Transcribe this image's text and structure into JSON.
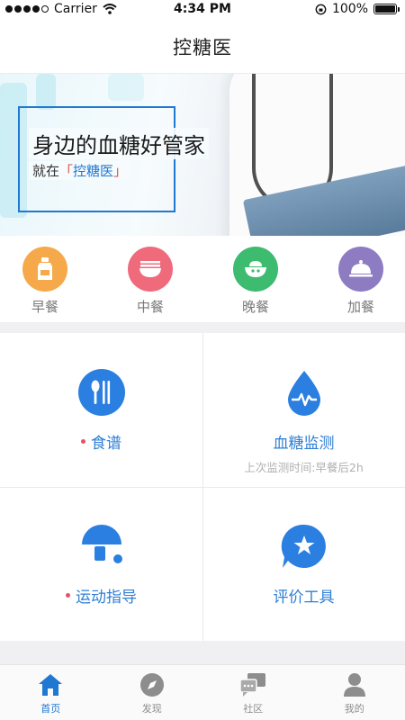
{
  "status_bar": {
    "carrier": "Carrier",
    "time": "4:34 PM",
    "battery": "100%"
  },
  "nav": {
    "title": "控糖医"
  },
  "banner": {
    "headline": "身边的血糖好管家",
    "sub_prefix": "就在",
    "sub_brand": "控糖医",
    "open_bracket": "「",
    "close_bracket": "」"
  },
  "meals": [
    {
      "label": "早餐",
      "color": "#f6a94a",
      "icon": "milk-bottle-icon"
    },
    {
      "label": "中餐",
      "color": "#ef6b7b",
      "icon": "noodle-bowl-icon"
    },
    {
      "label": "晚餐",
      "color": "#3dbb6f",
      "icon": "rice-bowl-icon"
    },
    {
      "label": "加餐",
      "color": "#8e7cc3",
      "icon": "cloche-icon"
    }
  ],
  "features": [
    {
      "label": "食谱",
      "subtitle": "",
      "icon": "spoon-fork-icon",
      "has_dot": true
    },
    {
      "label": "血糖监测",
      "subtitle": "上次监测时间:早餐后2h",
      "icon": "blood-drop-icon",
      "has_dot": false
    },
    {
      "label": "运动指导",
      "subtitle": "",
      "icon": "ping-pong-icon",
      "has_dot": true
    },
    {
      "label": "评价工具",
      "subtitle": "",
      "icon": "star-chat-icon",
      "has_dot": false
    }
  ],
  "tabs": [
    {
      "label": "首页",
      "icon": "home-icon",
      "active": true
    },
    {
      "label": "发现",
      "icon": "compass-icon",
      "active": false
    },
    {
      "label": "社区",
      "icon": "chat-bubbles-icon",
      "active": false
    },
    {
      "label": "我的",
      "icon": "person-icon",
      "active": false
    }
  ],
  "colors": {
    "accent": "#1f78d1",
    "dot": "#e8506a",
    "subtitle": "#b0b0b0"
  }
}
